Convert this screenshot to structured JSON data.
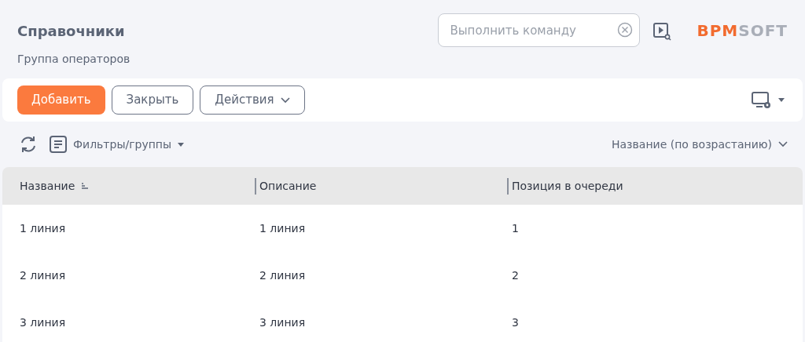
{
  "page": {
    "title": "Справочники",
    "subtitle": "Группа операторов"
  },
  "command": {
    "placeholder": "Выполнить команду"
  },
  "logo": {
    "part_1": "BPM",
    "part_2": "SOFT"
  },
  "toolbar": {
    "buttons": [
      {
        "label": "Добавить",
        "kind": "primary"
      },
      {
        "label": "Закрыть",
        "kind": "outline"
      },
      {
        "label": "Действия",
        "kind": "dropdown"
      }
    ]
  },
  "filters": {
    "label": "Фильтры/группы",
    "sort": "Название (по возрастанию)"
  },
  "table": {
    "columns": [
      {
        "label": "Название",
        "sorted": true
      },
      {
        "label": "Описание",
        "sorted": false
      },
      {
        "label": "Позиция в очереди",
        "sorted": false
      }
    ],
    "rows": [
      [
        "1 линия",
        "1 линия",
        "1"
      ],
      [
        "2 линия",
        "2 линия",
        "2"
      ],
      [
        "3 линия",
        "3 линия",
        "3"
      ]
    ]
  }
}
